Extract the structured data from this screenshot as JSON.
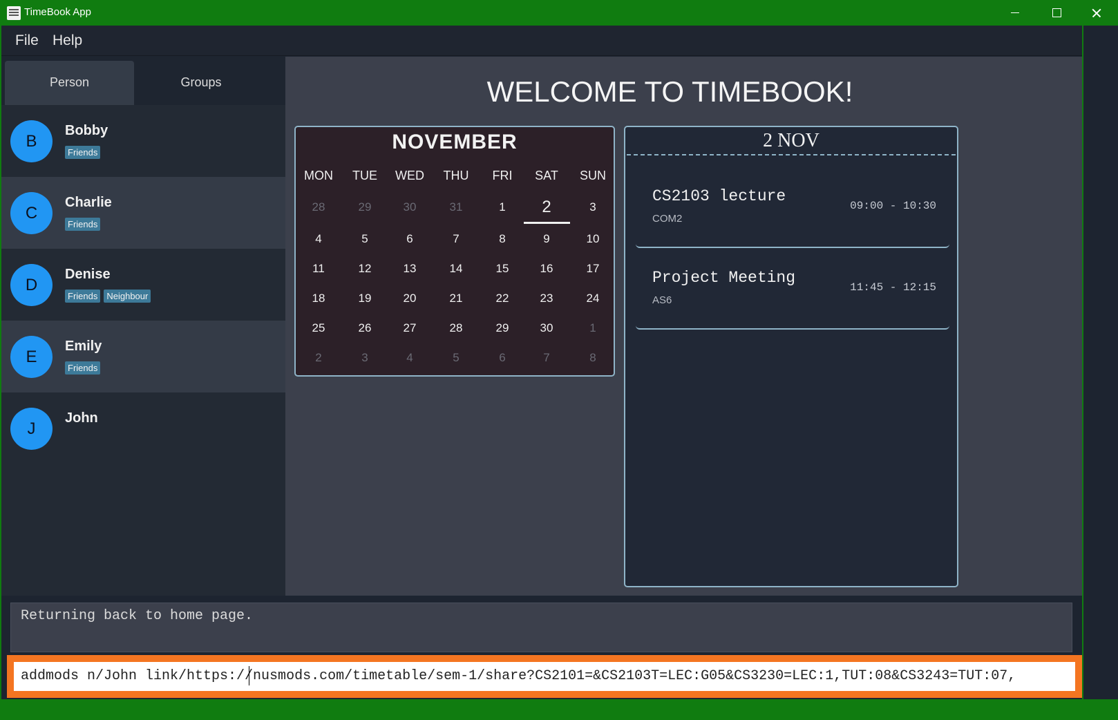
{
  "window": {
    "title": "TimeBook App"
  },
  "menu": {
    "file": "File",
    "help": "Help"
  },
  "tabs": {
    "person": "Person",
    "groups": "Groups"
  },
  "persons": [
    {
      "initial": "B",
      "name": "Bobby",
      "tags": [
        "Friends"
      ]
    },
    {
      "initial": "C",
      "name": "Charlie",
      "tags": [
        "Friends"
      ]
    },
    {
      "initial": "D",
      "name": "Denise",
      "tags": [
        "Friends",
        "Neighbour"
      ]
    },
    {
      "initial": "E",
      "name": "Emily",
      "tags": [
        "Friends"
      ]
    },
    {
      "initial": "J",
      "name": "John",
      "tags": []
    }
  ],
  "welcome": "WELCOME TO TIMEBOOK!",
  "calendar": {
    "month": "NOVEMBER",
    "days_of_week": [
      "MON",
      "TUE",
      "WED",
      "THU",
      "FRI",
      "SAT",
      "SUN"
    ],
    "weeks": [
      [
        "28",
        "29",
        "30",
        "31",
        "1",
        "2",
        "3"
      ],
      [
        "4",
        "5",
        "6",
        "7",
        "8",
        "9",
        "10"
      ],
      [
        "11",
        "12",
        "13",
        "14",
        "15",
        "16",
        "17"
      ],
      [
        "18",
        "19",
        "20",
        "21",
        "22",
        "23",
        "24"
      ],
      [
        "25",
        "26",
        "27",
        "28",
        "29",
        "30",
        "1"
      ],
      [
        "2",
        "3",
        "4",
        "5",
        "6",
        "7",
        "8"
      ]
    ],
    "selected": "2"
  },
  "schedule": {
    "date": "2 NOV",
    "events": [
      {
        "title": "CS2103 lecture",
        "location": "COM2",
        "time": "09:00 - 10:30"
      },
      {
        "title": "Project Meeting",
        "location": "AS6",
        "time": "11:45 - 12:15"
      }
    ]
  },
  "result": {
    "text": "Returning back to home page."
  },
  "command": {
    "text": "addmods n/John link/https://nusmods.com/timetable/sem-1/share?CS2101=&CS2103T=LEC:G05&CS3230=LEC:1,TUT:08&CS3243=TUT:07,"
  },
  "colors": {
    "titlebar": "#107c10",
    "accent": "#2196f3",
    "tag": "#3d7a99",
    "command_border": "#f47521"
  }
}
